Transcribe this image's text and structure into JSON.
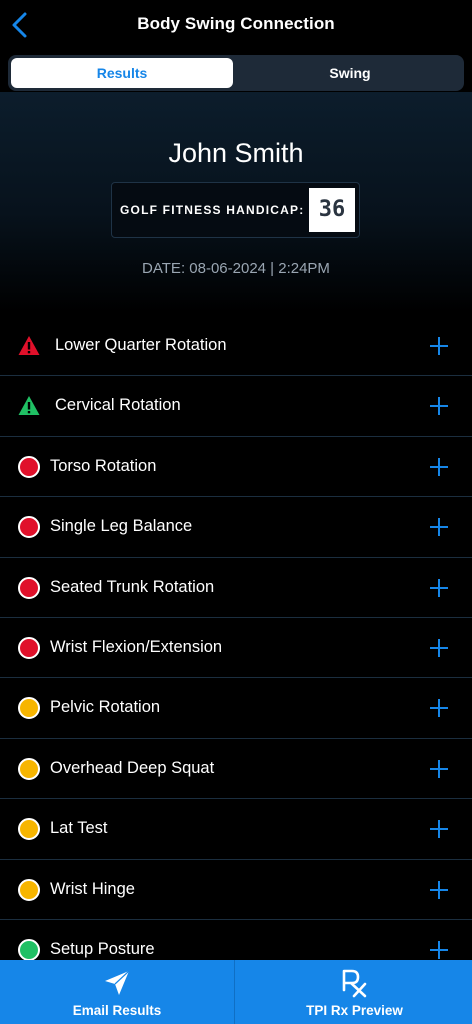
{
  "header": {
    "title": "Body Swing Connection",
    "back_icon": "chevron-left-icon"
  },
  "tabs": [
    {
      "label": "Results",
      "active": true
    },
    {
      "label": "Swing",
      "active": false
    }
  ],
  "profile": {
    "name": "John Smith",
    "handicap_label": "GOLF FITNESS HANDICAP:",
    "handicap_value": "36",
    "date": "DATE: 08-06-2024 | 2:24PM"
  },
  "colors": {
    "accent": "#1686e8",
    "red": "#e0102a",
    "green": "#20c064",
    "yellow": "#f7b500"
  },
  "results": [
    {
      "label": "Lower Quarter Rotation",
      "status": "warning-red",
      "icon": "warning-triangle-icon"
    },
    {
      "label": "Cervical Rotation",
      "status": "warning-green",
      "icon": "warning-triangle-icon"
    },
    {
      "label": "Torso Rotation",
      "status": "red",
      "icon": "status-dot-icon"
    },
    {
      "label": "Single Leg Balance",
      "status": "red",
      "icon": "status-dot-icon"
    },
    {
      "label": "Seated Trunk Rotation",
      "status": "red",
      "icon": "status-dot-icon"
    },
    {
      "label": "Wrist Flexion/Extension",
      "status": "red",
      "icon": "status-dot-icon"
    },
    {
      "label": "Pelvic Rotation",
      "status": "yellow",
      "icon": "status-dot-icon"
    },
    {
      "label": "Overhead Deep Squat",
      "status": "yellow",
      "icon": "status-dot-icon"
    },
    {
      "label": "Lat Test",
      "status": "yellow",
      "icon": "status-dot-icon"
    },
    {
      "label": "Wrist Hinge",
      "status": "yellow",
      "icon": "status-dot-icon"
    },
    {
      "label": "Setup Posture",
      "status": "green",
      "icon": "status-dot-icon"
    }
  ],
  "footer": {
    "email_label": "Email Results",
    "email_icon": "paper-plane-icon",
    "rx_label": "TPI Rx Preview",
    "rx_icon": "rx-icon"
  }
}
